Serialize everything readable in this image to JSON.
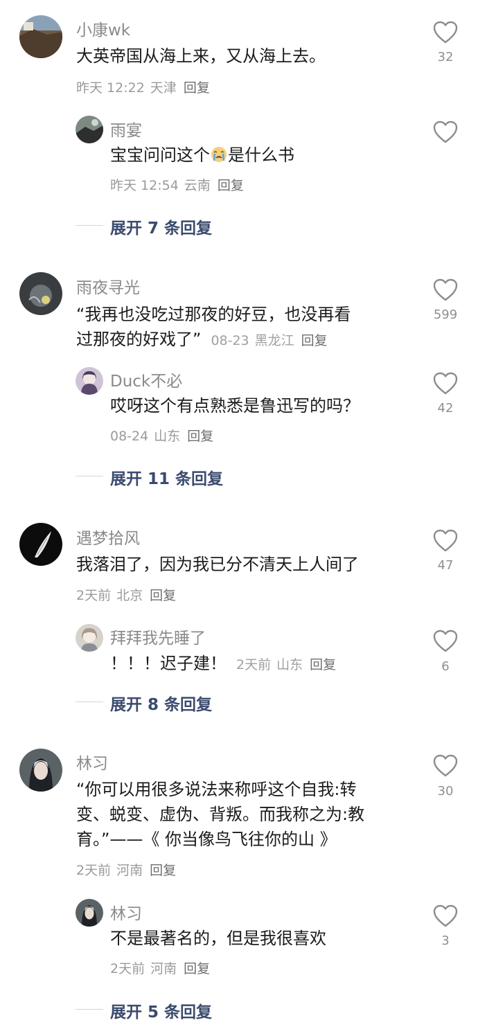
{
  "comments": [
    {
      "name": "小康wk",
      "text": "大英帝国从海上来，又从海上去。",
      "time": "昨天 12:22",
      "location": "天津",
      "reply_label": "回复",
      "likes": "32",
      "avatar_icon": "seaside-cliff-photo",
      "reply": {
        "name": "雨宴",
        "text_before": "宝宝问问这个",
        "emoji_icon": "crying-face-emoji",
        "text_after": "是什么书",
        "time": "昨天 12:54",
        "location": "云南",
        "reply_label": "回复",
        "likes": "",
        "avatar_icon": "landscape-photo"
      },
      "expand": "展开 7 条回复"
    },
    {
      "name": "雨夜寻光",
      "text_line1": "“我再也没吃过那夜的好豆，也没再看",
      "text_line2": "过那夜的好戏了”",
      "time": "08-23",
      "location": "黑龙江",
      "reply_label": "回复",
      "likes": "599",
      "avatar_icon": "dark-moon-photo",
      "reply": {
        "name": "Duck不必",
        "text": "哎呀这个有点熟悉是鲁迅写的吗？",
        "time": "08-24",
        "location": "山东",
        "reply_label": "回复",
        "likes": "42",
        "avatar_icon": "anime-girl-avatar"
      },
      "expand": "展开 11 条回复"
    },
    {
      "name": "遇梦拾风",
      "text": "我落泪了，因为我已分不清天上人间了",
      "time": "2天前",
      "location": "北京",
      "reply_label": "回复",
      "likes": "47",
      "avatar_icon": "white-feather-avatar",
      "reply": {
        "name": "拜拜我先睡了",
        "text": "！！！迟子建！",
        "time": "2天前",
        "location": "山东",
        "reply_label": "回复",
        "likes": "6",
        "avatar_icon": "illustrated-girl-avatar"
      },
      "expand": "展开 8 条回复"
    },
    {
      "name": "林习",
      "text_line1": "“你可以用很多说法来称呼这个自我:转",
      "text_line2": "变、蜕变、虚伪、背叛。而我称之为:教",
      "text_line3": "育。”——《 你当像鸟飞往你的山 》",
      "time": "2天前",
      "location": "河南",
      "reply_label": "回复",
      "likes": "30",
      "avatar_icon": "doll-portrait-avatar",
      "reply": {
        "name": "林习",
        "text": "不是最著名的，但是我很喜欢",
        "time": "2天前",
        "location": "河南",
        "reply_label": "回复",
        "likes": "3",
        "avatar_icon": "doll-portrait-avatar"
      },
      "expand": "展开 5 条回复"
    }
  ],
  "colors": {
    "background": "#ffffff",
    "name": "#8a8a8a",
    "text": "#1b1b1b",
    "meta": "#9a9a9a",
    "expand": "#3b4a6e"
  }
}
